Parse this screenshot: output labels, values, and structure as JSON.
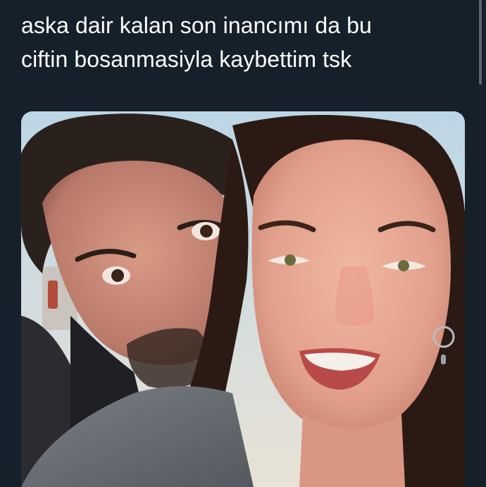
{
  "tweet": {
    "text_line_1": "aska dair kalan son inancımı da bu",
    "text_line_2": "ciftin bosanmasiyla kaybettim tsk"
  },
  "media": {
    "type": "photo",
    "description_icon": "selfie-photo"
  },
  "colors": {
    "background": "#15202b",
    "text": "#ffffff",
    "scrollbar": "#5b6670"
  }
}
